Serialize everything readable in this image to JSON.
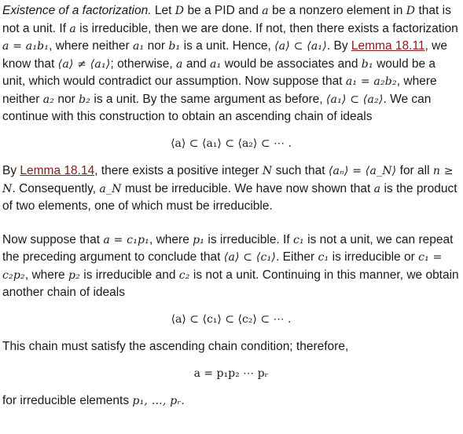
{
  "section1": {
    "heading": "Existence of a factorization.",
    "text_a": " Let ",
    "var_D": "D",
    "text_b": " be a PID and ",
    "var_a": "a",
    "text_c": " be a nonzero element in ",
    "text_d": " that is not a unit. If ",
    "text_e": " is irreducible, then we are done. If not, then there exists a factorization ",
    "math_fact1": "a = a₁b₁",
    "text_f": ", where neither ",
    "var_a1": "a₁",
    "text_g": " nor ",
    "var_b1": "b₁",
    "text_h": " is a unit. Hence, ",
    "math_incl1": "⟨a⟩ ⊂ ⟨a₁⟩",
    "text_i": ". By ",
    "link1": "Lemma 18.11",
    "text_j": ", we know that ",
    "math_neq": "⟨a⟩ ≠ ⟨a₁⟩",
    "text_k": "; otherwise, ",
    "text_l": " and ",
    "text_m": " would be associates and ",
    "text_n": " would be a unit, which would contradict our assumption. Now suppose that ",
    "math_fact2": "a₁ = a₂b₂",
    "text_o": ", where neither ",
    "var_a2": "a₂",
    "var_b2": "b₂",
    "text_p": " is a unit. By the same argument as before, ",
    "math_incl2": "⟨a₁⟩ ⊂ ⟨a₂⟩",
    "text_q": ". We can continue with this construction to obtain an ascending chain of ideals",
    "display1": "⟨a⟩ ⊂ ⟨a₁⟩ ⊂ ⟨a₂⟩ ⊂ ⋯ ."
  },
  "section2": {
    "text_a": "By ",
    "link2": "Lemma 18.14",
    "text_b": ", there exists a positive integer ",
    "var_N": "N",
    "text_c": " such that ",
    "math_eq": "⟨aₙ⟩ = ⟨a_N⟩",
    "text_d": " for all ",
    "math_geq": "n ≥ N",
    "text_e": ". Consequently, ",
    "var_aN": "a_N",
    "text_f": " must be irreducible. We have now shown that ",
    "var_a": "a",
    "text_g": " is the product of two elements, one of which must be irreducible."
  },
  "section3": {
    "text_a": "Now suppose that ",
    "math_fact3": "a = c₁p₁",
    "text_b": ", where ",
    "var_p1": "p₁",
    "text_c": " is irreducible. If ",
    "var_c1": "c₁",
    "text_d": " is not a unit, we can repeat the preceding argument to conclude that ",
    "math_incl3": "⟨a⟩ ⊂ ⟨c₁⟩",
    "text_e": ". Either ",
    "text_f": " is irreducible or ",
    "math_fact4": "c₁ = c₂p₂",
    "text_g": ", where ",
    "var_p2": "p₂",
    "text_h": " is irreducible and ",
    "var_c2": "c₂",
    "text_i": " is not a unit. Continuing in this manner, we obtain another chain of ideals",
    "display2": "⟨a⟩ ⊂ ⟨c₁⟩ ⊂ ⟨c₂⟩ ⊂ ⋯ ."
  },
  "section4": {
    "text_a": "This chain must satisfy the ascending chain condition; therefore,",
    "display3": "a = p₁p₂ ⋯ pᵣ",
    "text_b": "for irreducible elements ",
    "math_list": "p₁, …, pᵣ",
    "text_c": "."
  }
}
